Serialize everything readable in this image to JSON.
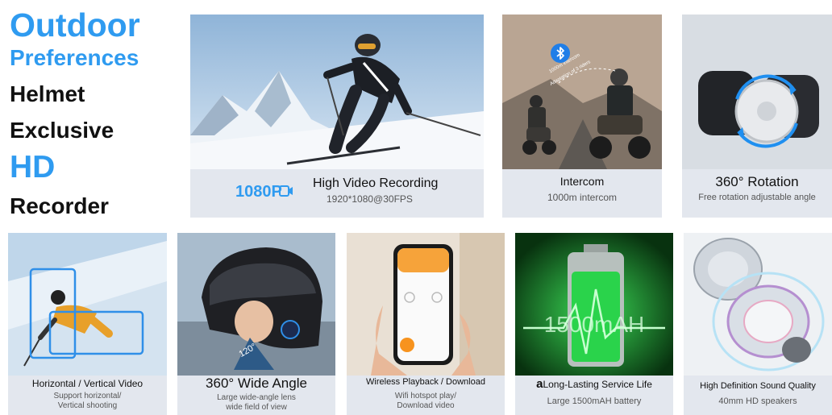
{
  "headline": {
    "line1": "Outdoor",
    "line2": "Preferences",
    "line3": "Helmet",
    "line4": "Exclusive",
    "line5": "HD",
    "line6": "Recorder"
  },
  "cards": {
    "video": {
      "badge": "1080P",
      "title": "High Video Recording",
      "subtitle": "1920*1080@30FPS"
    },
    "intercom": {
      "title": "Intercom",
      "subtitle": "1000m intercom",
      "overlay1": "1000m intercom",
      "overlay2": "Adaptation of 3 riders",
      "bluetooth_icon": "bluetooth-icon"
    },
    "rotation": {
      "title": "360° Rotation",
      "subtitle": "Free rotation adjustable angle"
    },
    "orientation": {
      "title": "Horizontal / Vertical Video",
      "subtitle1": "Support horizontal/",
      "subtitle2": "Vertical shooting"
    },
    "wideangle": {
      "title": "360° Wide Angle",
      "subtitle1": "Large wide-angle lens",
      "subtitle2": "wide field of view",
      "lens_label": "120°"
    },
    "wireless": {
      "title": "Wireless Playback / Download",
      "subtitle1": "Wifi hotspot play/",
      "subtitle2": "Download video"
    },
    "battery": {
      "title": "Long-Lasting Service Life",
      "title_prefix": "a",
      "subtitle": "Large 1500mAH battery",
      "overlay": "1500mAH"
    },
    "speaker": {
      "title": "High Definition Sound Quality",
      "subtitle": "40mm HD speakers"
    }
  },
  "colors": {
    "accent": "#2f9bf0",
    "caption_bg": "#e3e7ee",
    "battery_green": "#22c84a"
  }
}
